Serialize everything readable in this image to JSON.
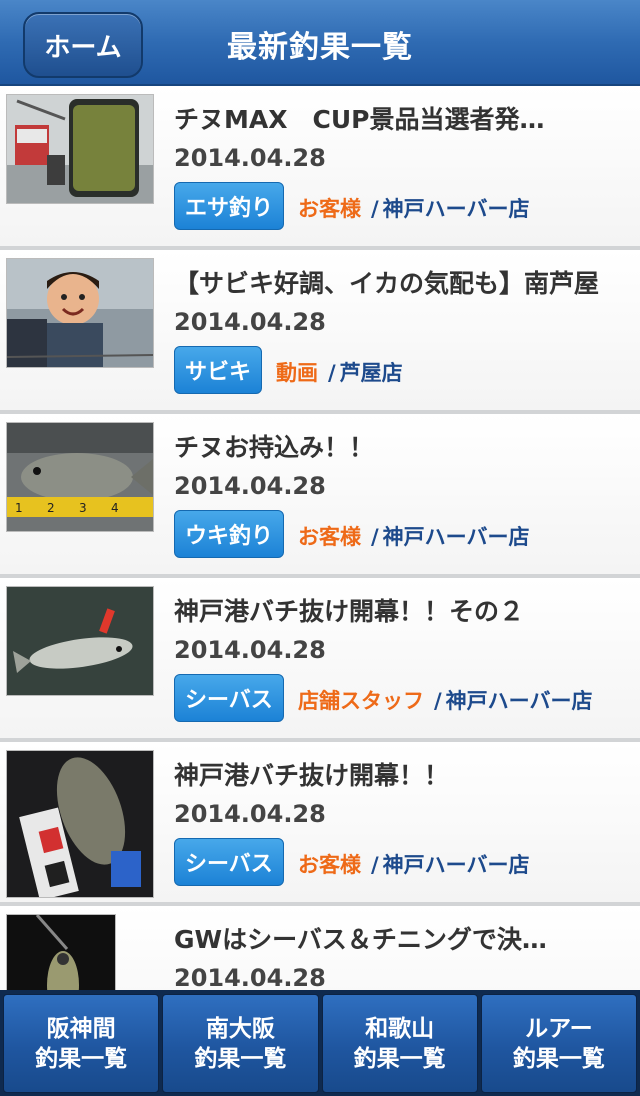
{
  "header": {
    "home_label": "ホーム",
    "title": "最新釣果一覧"
  },
  "items": [
    {
      "title": "チヌMAX　CUP景品当選者発…",
      "date": "2014.04.28",
      "tag": "エサ釣り",
      "author": "お客様",
      "sep": "/",
      "store": "神戸ハーバー店",
      "thumb": "tackle-photo"
    },
    {
      "title": "【サビキ好調、イカの気配も】南芦屋",
      "date": "2014.04.28",
      "tag": "サビキ",
      "author": "動画",
      "sep": "/",
      "store": "芦屋店",
      "thumb": "child-photo"
    },
    {
      "title": "チヌお持込み！！",
      "date": "2014.04.28",
      "tag": "ウキ釣り",
      "author": "お客様",
      "sep": "/",
      "store": "神戸ハーバー店",
      "thumb": "fish-ruler-photo"
    },
    {
      "title": "神戸港バチ抜け開幕！！その２",
      "date": "2014.04.28",
      "tag": "シーバス",
      "author": "店舗スタッフ",
      "sep": "/",
      "store": "神戸ハーバー店",
      "thumb": "seabass-photo"
    },
    {
      "title": "神戸港バチ抜け開幕！！",
      "date": "2014.04.28",
      "tag": "シーバス",
      "author": "お客様",
      "sep": "/",
      "store": "神戸ハーバー店",
      "thumb": "seabass-night-photo"
    },
    {
      "title": "GWはシーバス＆チニングで決…",
      "date": "2014.04.28",
      "thumb": "lure-photo"
    }
  ],
  "tabs": [
    {
      "line1": "阪神間",
      "line2": "釣果一覧"
    },
    {
      "line1": "南大阪",
      "line2": "釣果一覧"
    },
    {
      "line1": "和歌山",
      "line2": "釣果一覧"
    },
    {
      "line1": "ルアー",
      "line2": "釣果一覧"
    }
  ],
  "colors": {
    "header": "#2f6bb3",
    "tag": "#1c82d6",
    "author": "#ee6a18",
    "store": "#1d4a8c"
  }
}
